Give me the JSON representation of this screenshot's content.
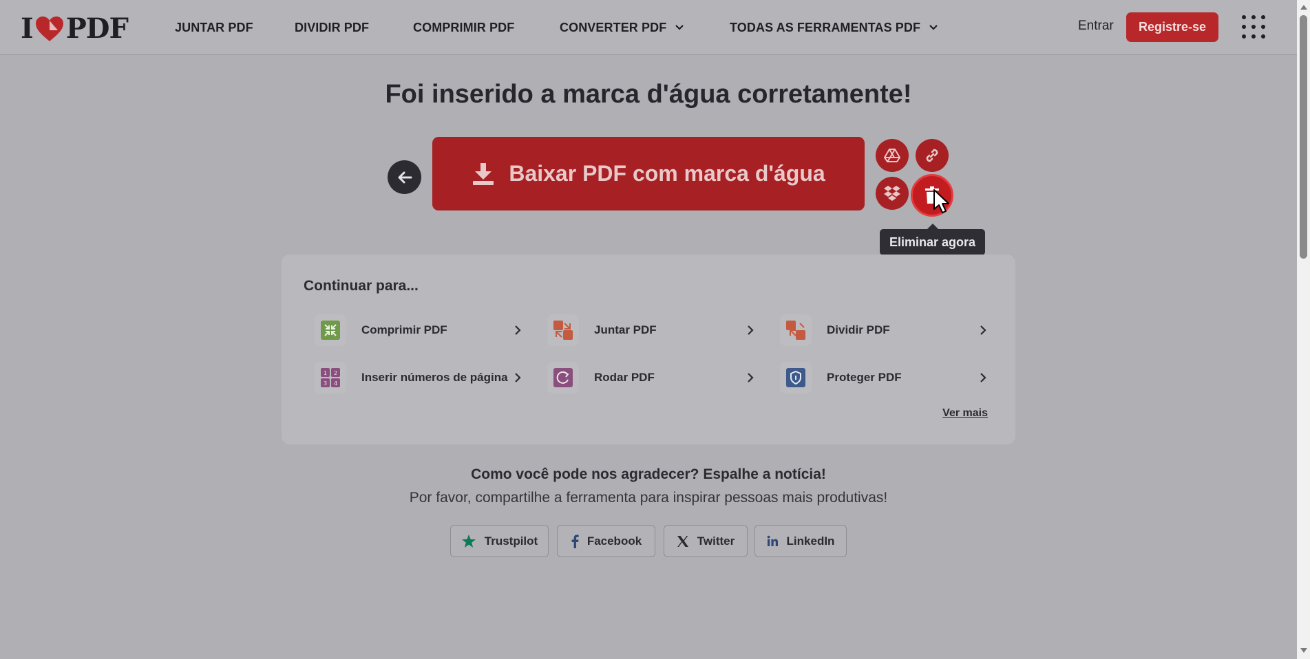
{
  "header": {
    "logo_left": "I",
    "logo_right": "PDF",
    "nav": [
      {
        "label": "JUNTAR PDF"
      },
      {
        "label": "DIVIDIR PDF"
      },
      {
        "label": "COMPRIMIR PDF"
      },
      {
        "label": "CONVERTER PDF"
      },
      {
        "label": "TODAS AS FERRAMENTAS PDF"
      }
    ],
    "login": "Entrar",
    "signup": "Registre-se"
  },
  "main": {
    "title": "Foi inserido a marca d'água corretamente!",
    "download_label": "Baixar PDF com marca d'água",
    "tooltip": "Eliminar agora"
  },
  "continue": {
    "title": "Continuar para...",
    "tools": [
      {
        "label": "Comprimir PDF",
        "icon": "compress-icon",
        "color": "#6f9a4a"
      },
      {
        "label": "Juntar PDF",
        "icon": "merge-icon",
        "color": "#c45a3f"
      },
      {
        "label": "Dividir PDF",
        "icon": "split-icon",
        "color": "#c45a3f"
      },
      {
        "label": "Inserir números de página",
        "icon": "page-numbers-icon",
        "color": "#8a4f7d"
      },
      {
        "label": "Rodar PDF",
        "icon": "rotate-icon",
        "color": "#8a4f7d"
      },
      {
        "label": "Proteger PDF",
        "icon": "shield-icon",
        "color": "#3e5a8a"
      }
    ],
    "more": "Ver mais"
  },
  "share": {
    "title": "Como você pode nos agradecer? Espalhe a notícia!",
    "subtitle": "Por favor, compartilhe a ferramenta para inspirar pessoas mais produtivas!",
    "buttons": [
      {
        "label": "Trustpilot",
        "icon": "star-icon"
      },
      {
        "label": "Facebook",
        "icon": "facebook-icon"
      },
      {
        "label": "Twitter",
        "icon": "x-icon"
      },
      {
        "label": "LinkedIn",
        "icon": "linkedin-icon"
      }
    ]
  },
  "colors": {
    "brand_red": "#a72023",
    "overlay_bg": "#b0afb3"
  }
}
